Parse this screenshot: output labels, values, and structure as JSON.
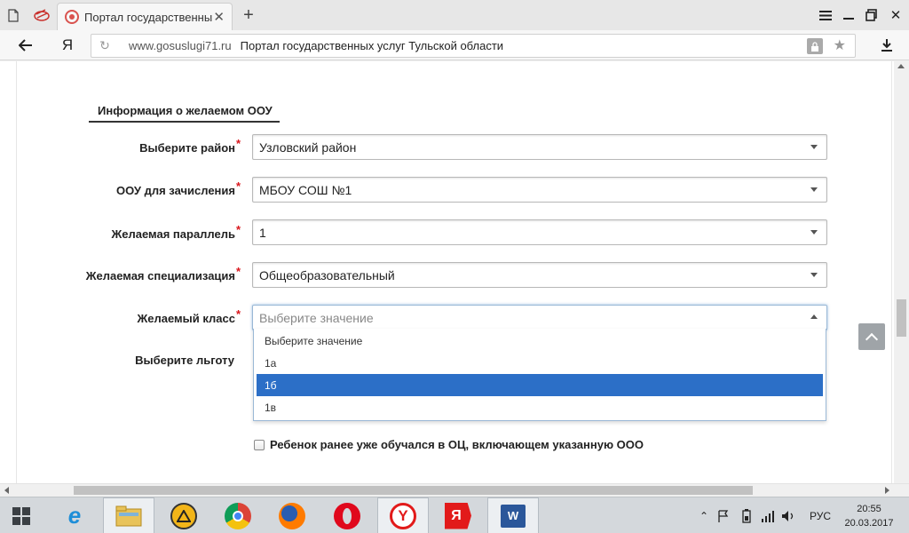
{
  "browser": {
    "tab_title": "Портал государственны",
    "url_domain": "www.gosuslugi71.ru",
    "page_title": "Портал государственных услуг Тульской области",
    "yandex_button": "Я"
  },
  "form": {
    "section_title": "Информация о желаемом ООУ",
    "fields": [
      {
        "label": "Выберите район",
        "value": "Узловский район",
        "required": true
      },
      {
        "label": "ООУ для зачисления",
        "value": "МБОУ СОШ №1",
        "required": true
      },
      {
        "label": "Желаемая параллель",
        "value": "1",
        "required": true
      },
      {
        "label": "Желаемая специализация",
        "value": "Общеобразовательный",
        "required": true
      },
      {
        "label": "Желаемый класс",
        "value": "Выберите значение",
        "required": true
      },
      {
        "label": "Выберите льготу",
        "value": "",
        "required": false
      }
    ],
    "dropdown_options": [
      "Выберите значение",
      "1а",
      "1б",
      "1в"
    ],
    "dropdown_selected": "1б",
    "checkbox_label": "Ребенок ранее уже обучался в ОЦ, включающем указанную ООО",
    "required_mark": "*"
  },
  "taskbar": {
    "apps": [
      "internet-explorer",
      "file-explorer",
      "aimp",
      "chrome",
      "firefox",
      "opera",
      "yandex-browser",
      "yandex",
      "word"
    ],
    "language": "РУС",
    "time": "20:55",
    "date": "20.03.2017"
  },
  "colors": {
    "selected_option": "#2c6fc7",
    "required_star": "#d9161c",
    "taskbar": "#d4d8dc"
  }
}
